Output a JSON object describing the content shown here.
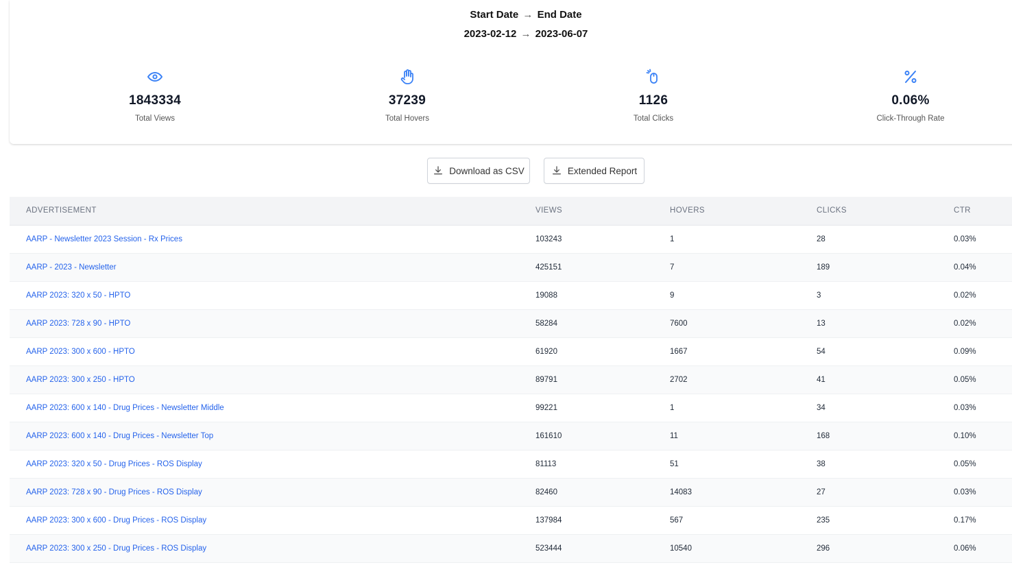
{
  "header": {
    "start_label": "Start Date",
    "end_label": "End Date",
    "start_date": "2023-02-12",
    "end_date": "2023-06-07",
    "arrow": "→"
  },
  "stats": [
    {
      "icon": "eye-icon",
      "value": "1843334",
      "label": "Total Views"
    },
    {
      "icon": "hand-icon",
      "value": "37239",
      "label": "Total Hovers"
    },
    {
      "icon": "mouse-click-icon",
      "value": "1126",
      "label": "Total Clicks"
    },
    {
      "icon": "percent-icon",
      "value": "0.06%",
      "label": "Click-Through Rate"
    }
  ],
  "actions": {
    "download_csv": "Download as CSV",
    "extended_report": "Extended Report"
  },
  "table": {
    "columns": [
      "ADVERTISEMENT",
      "VIEWS",
      "HOVERS",
      "CLICKS",
      "CTR"
    ],
    "rows": [
      [
        "AARP - Newsletter 2023 Session - Rx Prices",
        "103243",
        "1",
        "28",
        "0.03%"
      ],
      [
        "AARP - 2023 - Newsletter",
        "425151",
        "7",
        "189",
        "0.04%"
      ],
      [
        "AARP 2023: 320 x 50 - HPTO",
        "19088",
        "9",
        "3",
        "0.02%"
      ],
      [
        "AARP 2023: 728 x 90 - HPTO",
        "58284",
        "7600",
        "13",
        "0.02%"
      ],
      [
        "AARP 2023: 300 x 600 - HPTO",
        "61920",
        "1667",
        "54",
        "0.09%"
      ],
      [
        "AARP 2023: 300 x 250 - HPTO",
        "89791",
        "2702",
        "41",
        "0.05%"
      ],
      [
        "AARP 2023: 600 x 140 - Drug Prices - Newsletter Middle",
        "99221",
        "1",
        "34",
        "0.03%"
      ],
      [
        "AARP 2023: 600 x 140 - Drug Prices - Newsletter Top",
        "161610",
        "11",
        "168",
        "0.10%"
      ],
      [
        "AARP 2023: 320 x 50 - Drug Prices - ROS Display",
        "81113",
        "51",
        "38",
        "0.05%"
      ],
      [
        "AARP 2023: 728 x 90 - Drug Prices - ROS Display",
        "82460",
        "14083",
        "27",
        "0.03%"
      ],
      [
        "AARP 2023: 300 x 600 - Drug Prices - ROS Display",
        "137984",
        "567",
        "235",
        "0.17%"
      ],
      [
        "AARP 2023: 300 x 250 - Drug Prices - ROS Display",
        "523444",
        "10540",
        "296",
        "0.06%"
      ]
    ]
  },
  "colors": {
    "accent": "#2563eb",
    "icon_blue": "#3b82f6",
    "header_bg": "#f3f4f6"
  }
}
